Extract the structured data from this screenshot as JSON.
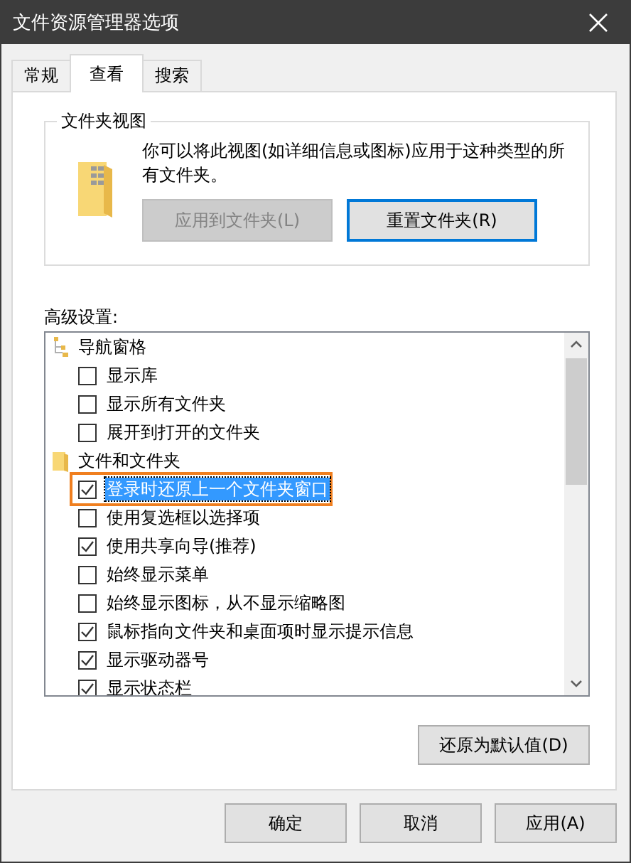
{
  "window": {
    "title": "文件资源管理器选项"
  },
  "tabs": [
    {
      "label": "常规",
      "selected": false
    },
    {
      "label": "查看",
      "selected": true
    },
    {
      "label": "搜索",
      "selected": false
    }
  ],
  "folder_views": {
    "title": "文件夹视图",
    "description": "你可以将此视图(如详细信息或图标)应用于这种类型的所有文件夹。",
    "buttons": [
      {
        "label": "应用到文件夹(L)",
        "disabled": true,
        "default": false
      },
      {
        "label": "重置文件夹(R)",
        "disabled": false,
        "default": true
      }
    ]
  },
  "advanced": {
    "label": "高级设置:",
    "groups": [
      {
        "kind": "navigation",
        "label": "导航窗格",
        "children": [
          {
            "label": "显示库",
            "checked": false,
            "selected": false,
            "highlighted": false
          },
          {
            "label": "显示所有文件夹",
            "checked": false,
            "selected": false,
            "highlighted": false
          },
          {
            "label": "展开到打开的文件夹",
            "checked": false,
            "selected": false,
            "highlighted": false
          }
        ]
      },
      {
        "kind": "folder",
        "label": "文件和文件夹",
        "children": [
          {
            "label": "登录时还原上一个文件夹窗口",
            "checked": true,
            "selected": true,
            "highlighted": true
          },
          {
            "label": "使用复选框以选择项",
            "checked": false,
            "selected": false,
            "highlighted": false
          },
          {
            "label": "使用共享向导(推荐)",
            "checked": true,
            "selected": false,
            "highlighted": false
          },
          {
            "label": "始终显示菜单",
            "checked": false,
            "selected": false,
            "highlighted": false
          },
          {
            "label": "始终显示图标，从不显示缩略图",
            "checked": false,
            "selected": false,
            "highlighted": false
          },
          {
            "label": "鼠标指向文件夹和桌面项时显示提示信息",
            "checked": true,
            "selected": false,
            "highlighted": false
          },
          {
            "label": "显示驱动器号",
            "checked": true,
            "selected": false,
            "highlighted": false
          },
          {
            "label": "显示状态栏",
            "checked": true,
            "selected": false,
            "highlighted": false
          }
        ]
      }
    ]
  },
  "restore_button": "还原为默认值(D)",
  "buttons": [
    "确定",
    "取消",
    "应用(A)"
  ]
}
